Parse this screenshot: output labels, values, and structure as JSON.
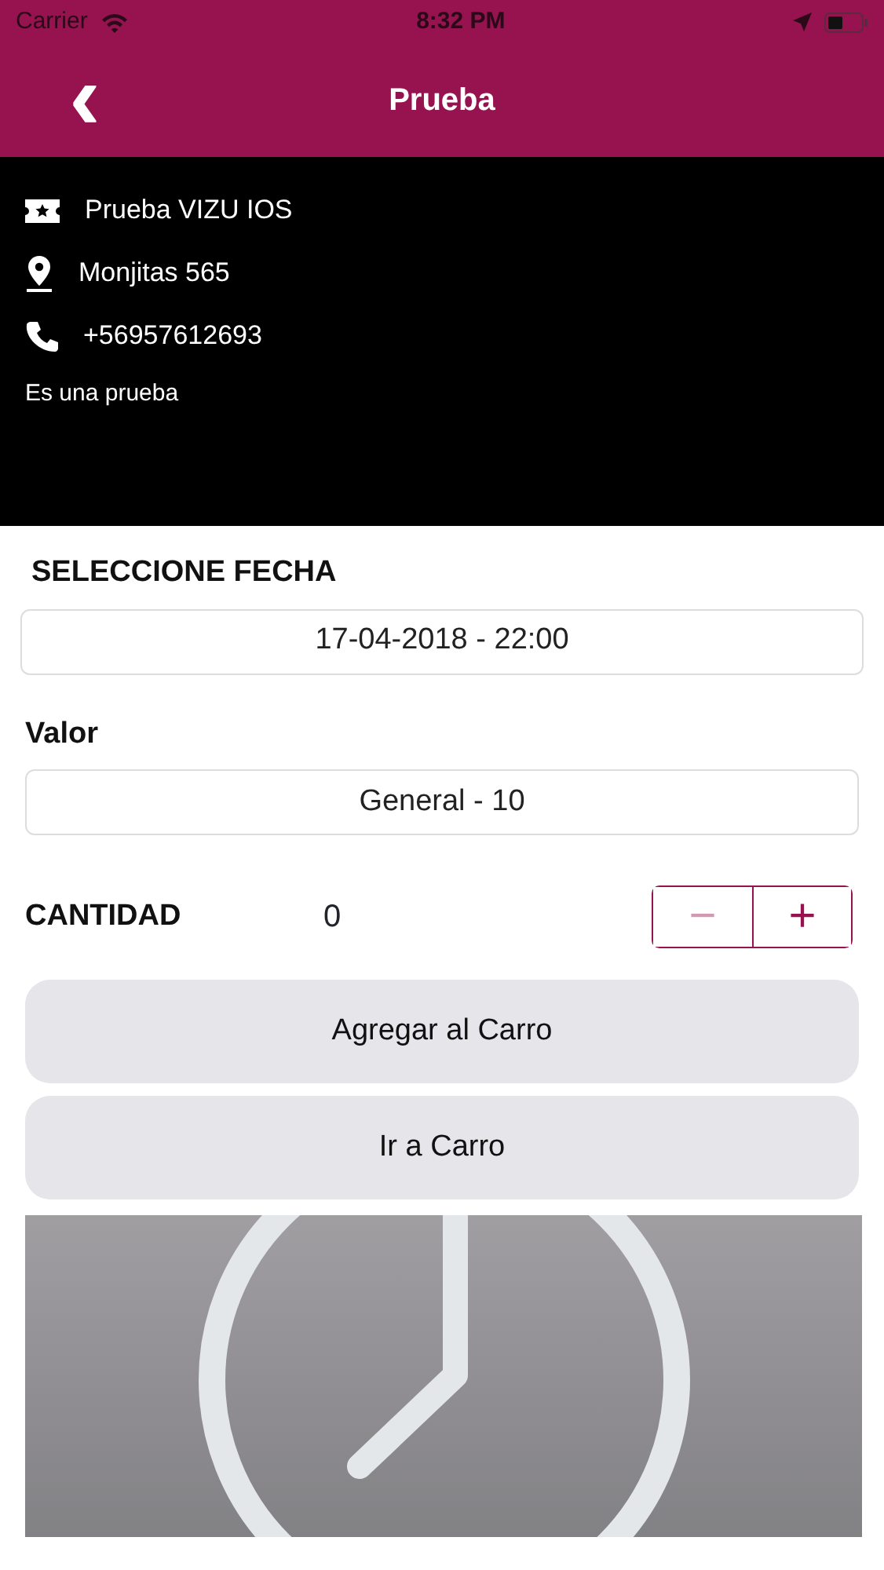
{
  "status_bar": {
    "carrier": "Carrier",
    "time": "8:32 PM"
  },
  "nav": {
    "back": "‹",
    "title": "Prueba"
  },
  "info": {
    "rows": [
      {
        "kind": "ticket",
        "text": "Prueba VIZU IOS"
      },
      {
        "kind": "pin",
        "text": "Monjitas 565"
      },
      {
        "kind": "phone",
        "text": "+56957612693"
      }
    ],
    "description": "Es una prueba"
  },
  "date": {
    "label": "SELECCIONE FECHA",
    "value": "17-04-2018 - 22:00"
  },
  "price": {
    "label": "Valor",
    "value": "General - 10"
  },
  "quantity": {
    "label": "CANTIDAD",
    "value": "0",
    "minus": {
      "symbol": "−",
      "disabled": true
    },
    "plus": {
      "symbol": "+",
      "disabled": false
    }
  },
  "buttons": [
    "Agregar al Carro",
    "Ir a Carro"
  ],
  "image": {
    "kind": "picture"
  }
}
